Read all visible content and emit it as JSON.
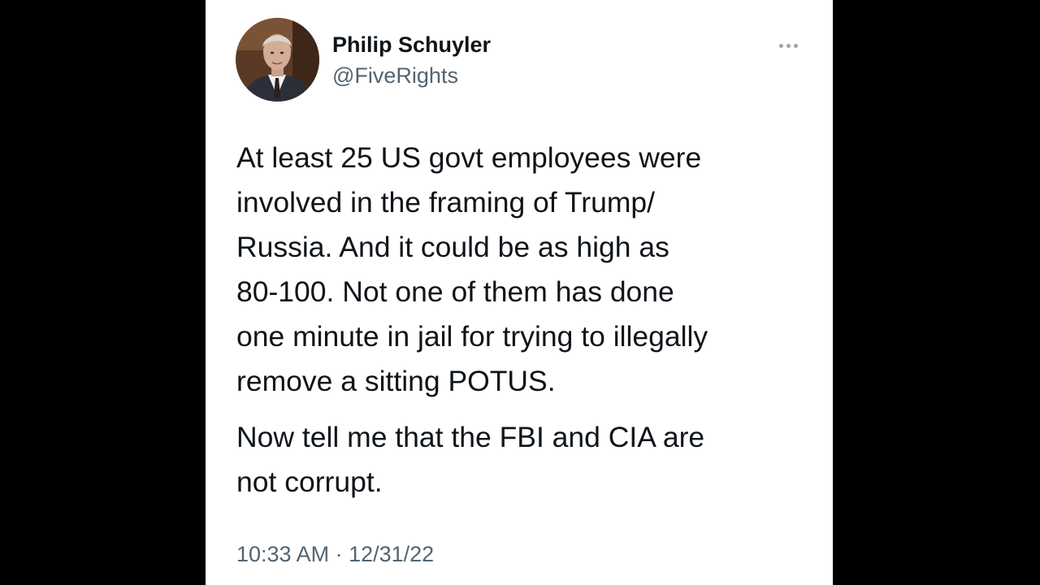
{
  "tweet": {
    "author": {
      "display_name": "Philip Schuyler",
      "handle": "@FiveRights",
      "avatar_icon": "profile-photo"
    },
    "more_icon": "ellipsis-horizontal-icon",
    "paragraphs": [
      "At least 25 US govt employees were\ninvolved in the framing of Trump/\nRussia. And it could be as high as\n80-100. Not one of them has done\none minute in jail for trying to illegally\nremove a sitting POTUS.",
      "Now tell me that the FBI and CIA are\nnot corrupt."
    ],
    "timestamp": "10:33 AM · 12/31/22"
  },
  "colors": {
    "background": "#000000",
    "card": "#ffffff",
    "text_primary": "#0f1419",
    "text_secondary": "#536471"
  }
}
